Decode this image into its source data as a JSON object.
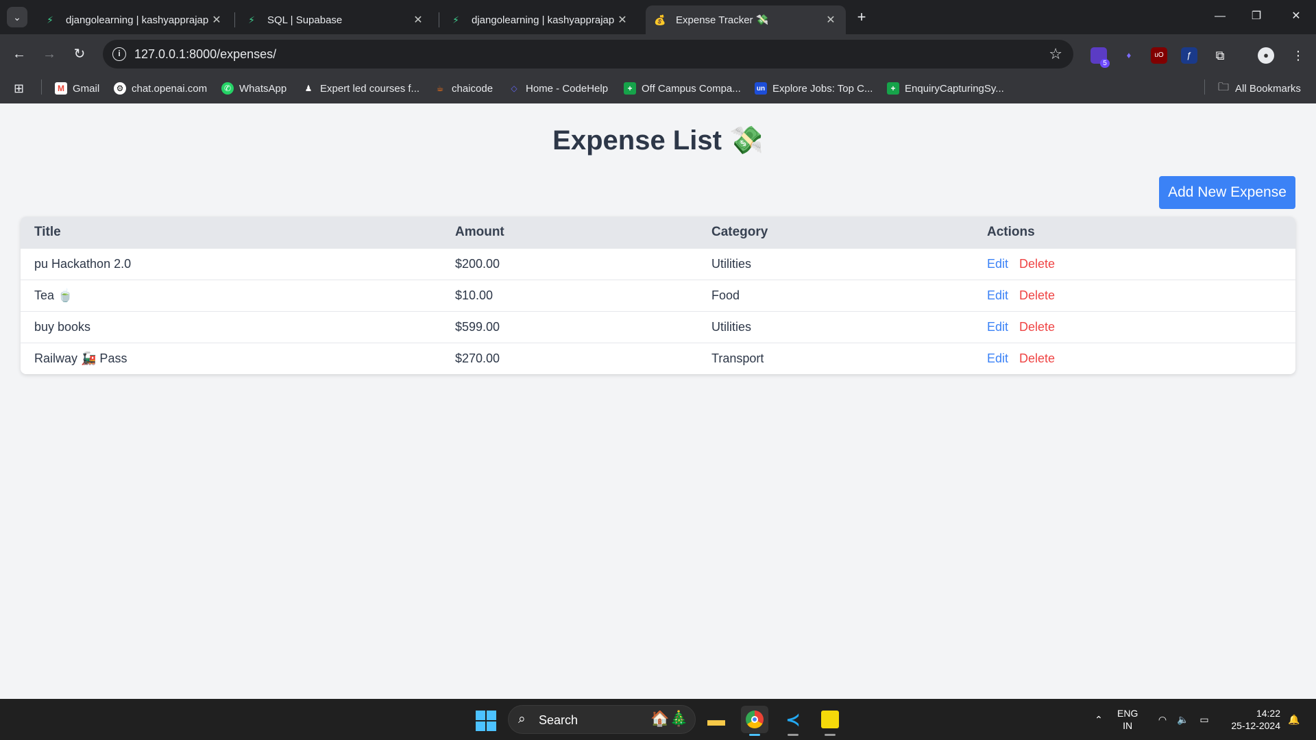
{
  "browser": {
    "tabs": [
      {
        "title": "djangolearning | kashyapprajap",
        "icon": "supabase-icon"
      },
      {
        "title": "SQL | Supabase",
        "icon": "supabase-icon"
      },
      {
        "title": "djangolearning | kashyapprajap",
        "icon": "supabase-icon"
      },
      {
        "title": "Expense Tracker 💸",
        "icon": "money-bag-icon"
      }
    ],
    "active_tab": 3,
    "url": "127.0.0.1:8000/expenses/",
    "bookmarks": [
      {
        "label": "Gmail",
        "icon": "gmail-icon"
      },
      {
        "label": "chat.openai.com",
        "icon": "openai-icon"
      },
      {
        "label": "WhatsApp",
        "icon": "whatsapp-icon"
      },
      {
        "label": "Expert led courses f...",
        "icon": "courses-icon"
      },
      {
        "label": "chaicode",
        "icon": "chaicode-icon"
      },
      {
        "label": "Home - CodeHelp",
        "icon": "codehelp-icon"
      },
      {
        "label": "Off Campus Compa...",
        "icon": "sheets-icon"
      },
      {
        "label": "Explore Jobs: Top C...",
        "icon": "unstop-icon"
      },
      {
        "label": "EnquiryCapturingSy...",
        "icon": "sheets-icon"
      }
    ],
    "all_bookmarks": "All Bookmarks",
    "extension_badge": "5"
  },
  "page": {
    "title": "Expense List 💸",
    "add_button": "Add New Expense",
    "table": {
      "headers": [
        "Title",
        "Amount",
        "Category",
        "Actions"
      ],
      "rows": [
        {
          "title": "pu Hackathon 2.0",
          "amount": "$200.00",
          "category": "Utilities",
          "edit": "Edit",
          "delete": "Delete"
        },
        {
          "title": "Tea 🍵",
          "amount": "$10.00",
          "category": "Food",
          "edit": "Edit",
          "delete": "Delete"
        },
        {
          "title": "buy books",
          "amount": "$599.00",
          "category": "Utilities",
          "edit": "Edit",
          "delete": "Delete"
        },
        {
          "title": "Railway 🚂 Pass",
          "amount": "$270.00",
          "category": "Transport",
          "edit": "Edit",
          "delete": "Delete"
        }
      ]
    },
    "colors": {
      "primary": "#3b82f6",
      "danger": "#ef4444",
      "header_bg": "#e5e7eb",
      "page_bg": "#f3f4f6"
    }
  },
  "taskbar": {
    "search_label": "Search",
    "language": "ENG",
    "region": "IN",
    "time": "14:22",
    "date": "25-12-2024"
  }
}
